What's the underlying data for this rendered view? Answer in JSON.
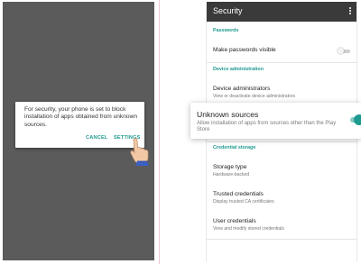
{
  "left_screen": {
    "dialog": {
      "message": "For security, your phone is set to block installation of apps obtained from unknown sources.",
      "cancel_label": "CANCEL",
      "settings_label": "SETTINGS"
    },
    "pointer_icon": "hand-pointer-icon"
  },
  "right_screen": {
    "app_bar": {
      "title": "Security",
      "menu_icon": "more-vert-icon"
    },
    "sections": {
      "passwords_header": "Passwords",
      "make_passwords_visible": "Make passwords visible",
      "make_passwords_visible_on": false,
      "device_admin_header": "Device administration",
      "device_administrators": "Device administrators",
      "device_administrators_sub": "View or deactivate device administrators",
      "unknown_sources": "Unknown sources",
      "unknown_sources_sub": "Allow installation of apps from sources other than the Play Store",
      "unknown_sources_on": true,
      "credential_storage_header": "Credential storage",
      "storage_type": "Storage type",
      "storage_type_sub": "Hardware-backed",
      "trusted_credentials": "Trusted credentials",
      "trusted_credentials_sub": "Display trusted CA certificates",
      "user_credentials": "User credentials",
      "user_credentials_sub": "View and modify stored credentials"
    }
  },
  "colors": {
    "accent": "#1e9a8f",
    "app_bar": "#3a3a3a",
    "dim_background": "#5b5b5b",
    "divider_pink": "#f2c5d0"
  }
}
